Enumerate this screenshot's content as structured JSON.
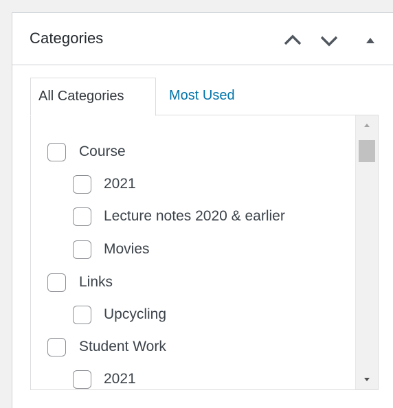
{
  "panel": {
    "title": "Categories",
    "controls": {
      "move_up_icon": "chevron-up-icon",
      "move_down_icon": "chevron-down-icon",
      "toggle_icon": "triangle-up-icon"
    }
  },
  "tabs": [
    {
      "label": "All Categories",
      "active": true
    },
    {
      "label": "Most Used",
      "active": false
    }
  ],
  "categories": [
    {
      "label": "Course",
      "level": 0,
      "checked": false
    },
    {
      "label": "2021",
      "level": 1,
      "checked": false
    },
    {
      "label": "Lecture notes 2020 & earlier",
      "level": 1,
      "checked": false
    },
    {
      "label": "Movies",
      "level": 1,
      "checked": false
    },
    {
      "label": "Links",
      "level": 0,
      "checked": false
    },
    {
      "label": "Upcycling",
      "level": 1,
      "checked": false
    },
    {
      "label": "Student Work",
      "level": 0,
      "checked": false
    },
    {
      "label": "2021",
      "level": 1,
      "checked": false
    }
  ],
  "colors": {
    "link": "#0073aa",
    "text": "#23282d",
    "border": "#ccd0d4"
  }
}
